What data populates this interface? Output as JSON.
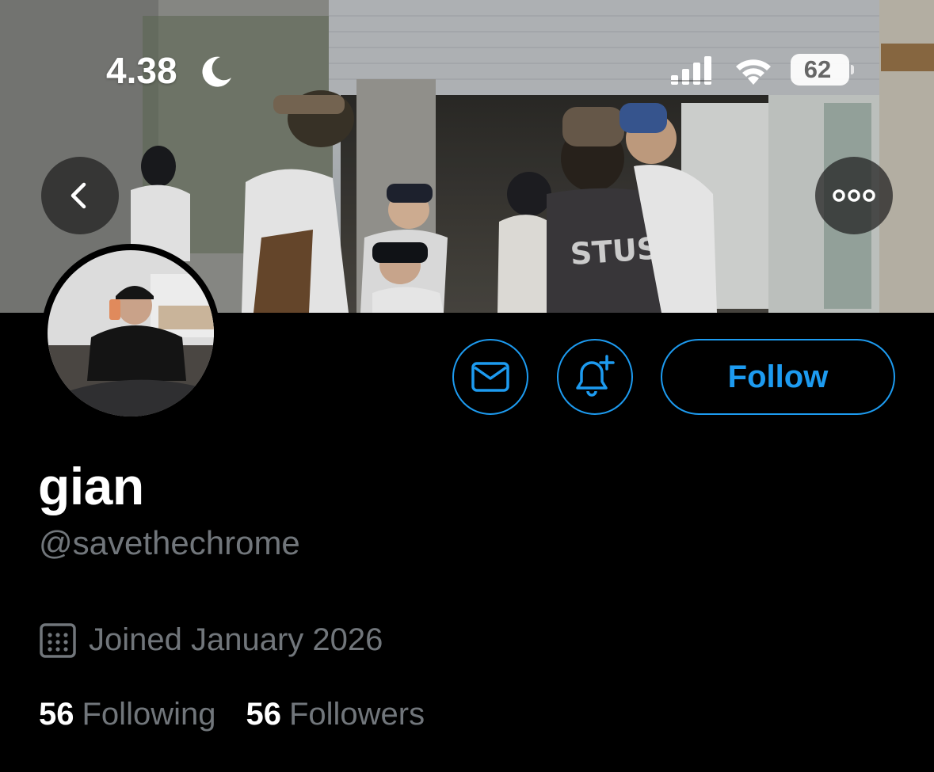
{
  "status_bar": {
    "time": "4.38",
    "battery": "62",
    "icons": [
      "moon-icon",
      "signal-icon",
      "wifi-icon",
      "battery-icon"
    ]
  },
  "banner": {
    "header_icons": [
      "back-arrow-icon",
      "more-options-icon"
    ]
  },
  "actions": {
    "message_icon": "envelope-icon",
    "notify_icon": "bell-plus-icon",
    "follow_label": "Follow"
  },
  "profile": {
    "display_name": "gian",
    "handle": "@savethechrome",
    "joined": "Joined January 2026",
    "following_count": "56",
    "following_label": "Following",
    "followers_count": "56",
    "followers_label": "Followers"
  },
  "colors": {
    "accent": "#1d9bf0",
    "background": "#000000",
    "secondary_text": "#71767b",
    "primary_text": "#ffffff"
  }
}
